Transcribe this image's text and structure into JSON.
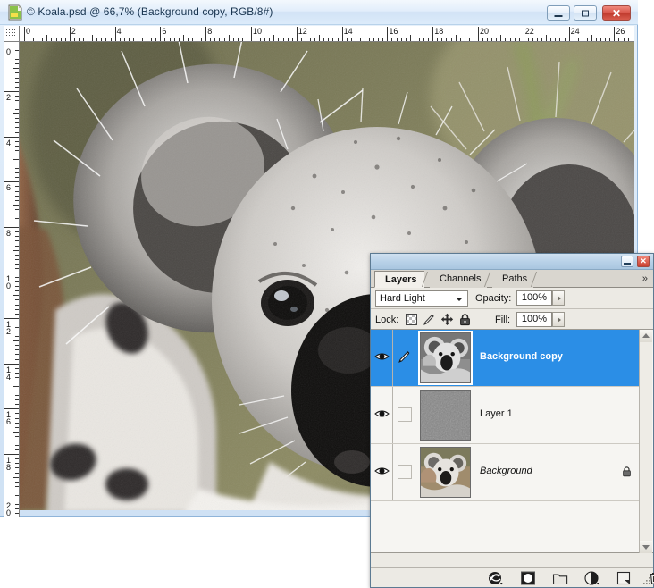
{
  "window": {
    "title": "© Koala.psd @ 66,7% (Background copy, RGB/8#)",
    "icon": "photoshop-document-icon",
    "buttons": {
      "minimize": "minimize-button",
      "maximize": "maximize-button",
      "close_glyph": "✕"
    }
  },
  "rulers": {
    "unit_step": 2,
    "horizontal_labels": [
      "0",
      "2",
      "4",
      "6",
      "8",
      "10",
      "12",
      "14",
      "16",
      "18",
      "20",
      "22",
      "24",
      "26"
    ],
    "vertical_labels": [
      "0",
      "2",
      "4",
      "6",
      "8",
      "10",
      "12",
      "14",
      "16",
      "18",
      "20"
    ]
  },
  "canvas": {
    "subject": "koala photograph, desaturated hard-light composite"
  },
  "panel": {
    "titlebar": {
      "minimize": "minimize-panel-button",
      "close_glyph": "✕"
    },
    "tabs": [
      {
        "label": "Layers",
        "active": true
      },
      {
        "label": "Channels",
        "active": false
      },
      {
        "label": "Paths",
        "active": false
      }
    ],
    "tabs_overflow": "»",
    "blend": {
      "mode": "Hard Light",
      "opacity_label": "Opacity:",
      "opacity_value": "100%"
    },
    "lock": {
      "label": "Lock:",
      "items": [
        "lock-transparent-pixels-icon",
        "lock-image-pixels-icon",
        "lock-position-icon",
        "lock-all-icon"
      ],
      "fill_label": "Fill:",
      "fill_value": "100%"
    },
    "layers": [
      {
        "name": "Background copy",
        "selected": true,
        "visible": true,
        "italic": false,
        "locked": false,
        "thumb": "koala-gray",
        "second_cell_icon": "brush-icon"
      },
      {
        "name": "Layer 1",
        "selected": false,
        "visible": true,
        "italic": false,
        "locked": false,
        "thumb": "noise-gray",
        "second_cell_icon": ""
      },
      {
        "name": "Background",
        "selected": false,
        "visible": true,
        "italic": true,
        "locked": true,
        "thumb": "koala-color",
        "second_cell_icon": ""
      }
    ],
    "footer_buttons": [
      "link-layers-icon",
      "add-layer-mask-icon",
      "new-group-icon",
      "new-adjustment-layer-icon",
      "new-layer-icon",
      "delete-layer-icon"
    ]
  },
  "colors": {
    "selection_blue": "#2b8ee6",
    "title_blue": "#d2e3f6",
    "panel_gray": "#eceae4",
    "close_red": "#c9402f"
  }
}
